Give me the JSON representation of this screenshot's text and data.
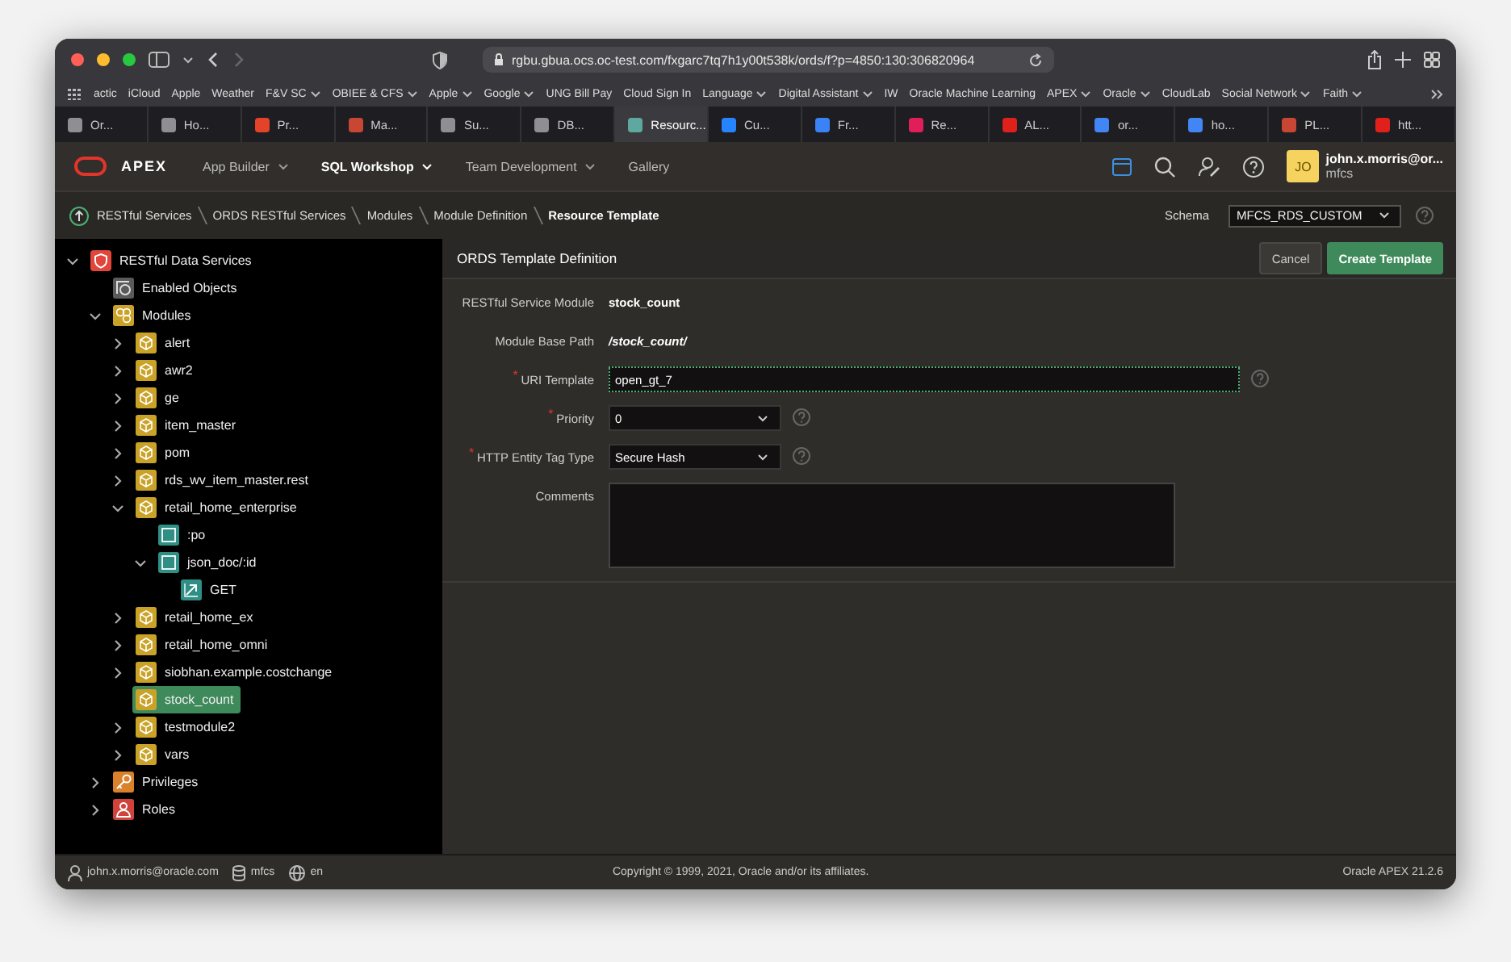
{
  "browser": {
    "url": "rgbu.gbua.ocs.oc-test.com/fxgarc7tq7h1y00t538k/ords/f?p=4850:130:306820964",
    "bookmarks": [
      {
        "label": "actic",
        "menu": false
      },
      {
        "label": "iCloud",
        "menu": false
      },
      {
        "label": "Apple",
        "menu": false
      },
      {
        "label": "Weather",
        "menu": false
      },
      {
        "label": "F&V SC",
        "menu": true
      },
      {
        "label": "OBIEE & CFS",
        "menu": true
      },
      {
        "label": "Apple",
        "menu": true
      },
      {
        "label": "Google",
        "menu": true
      },
      {
        "label": "UNG Bill Pay",
        "menu": false
      },
      {
        "label": "Cloud Sign In",
        "menu": false
      },
      {
        "label": "Language",
        "menu": true
      },
      {
        "label": "Digital Assistant",
        "menu": true
      },
      {
        "label": "IW",
        "menu": false
      },
      {
        "label": "Oracle Machine Learning",
        "menu": false
      },
      {
        "label": "APEX",
        "menu": true
      },
      {
        "label": "Oracle",
        "menu": true
      },
      {
        "label": "CloudLab",
        "menu": false
      },
      {
        "label": "Social Network",
        "menu": true
      },
      {
        "label": "Faith",
        "menu": true
      }
    ],
    "tabs": [
      {
        "label": "Or...",
        "selected": false,
        "color": "#8e8e93"
      },
      {
        "label": "Ho...",
        "selected": false,
        "color": "#8e8e93"
      },
      {
        "label": "Pr...",
        "selected": false,
        "color": "#e24329"
      },
      {
        "label": "Ma...",
        "selected": false,
        "color": "#c74634"
      },
      {
        "label": "Su...",
        "selected": false,
        "color": "#8e8e93"
      },
      {
        "label": "DB...",
        "selected": false,
        "color": "#8e8e93"
      },
      {
        "label": "Resourc...",
        "selected": true,
        "color": "#5fa8a0"
      },
      {
        "label": "Cu...",
        "selected": false,
        "color": "#2684ff"
      },
      {
        "label": "Fr...",
        "selected": false,
        "color": "#3b82f6"
      },
      {
        "label": "Re...",
        "selected": false,
        "color": "#e01e5a"
      },
      {
        "label": "AL...",
        "selected": false,
        "color": "#e0201b"
      },
      {
        "label": "or...",
        "selected": false,
        "color": "#4285f4"
      },
      {
        "label": "ho...",
        "selected": false,
        "color": "#4285f4"
      },
      {
        "label": "PL...",
        "selected": false,
        "color": "#c74634"
      },
      {
        "label": "htt...",
        "selected": false,
        "color": "#e0201b"
      }
    ]
  },
  "apex": {
    "logo": "APEX",
    "nav": [
      {
        "label": "App Builder",
        "selected": false
      },
      {
        "label": "SQL Workshop",
        "selected": true
      },
      {
        "label": "Team Development",
        "selected": false
      },
      {
        "label": "Gallery",
        "selected": false
      }
    ],
    "user": {
      "initials": "JO",
      "name": "john.x.morris@or...",
      "workspace": "mfcs"
    }
  },
  "breadcrumb": [
    {
      "label": "RESTful Services",
      "current": false
    },
    {
      "label": "ORDS RESTful Services",
      "current": false
    },
    {
      "label": "Modules",
      "current": false
    },
    {
      "label": "Module Definition",
      "current": false
    },
    {
      "label": "Resource Template",
      "current": true
    }
  ],
  "schema": {
    "label": "Schema",
    "value": "MFCS_RDS_CUSTOM"
  },
  "tree": [
    {
      "label": "RESTful Data Services",
      "kind": "service",
      "expanded": true,
      "selected": false,
      "children": [
        {
          "label": "Enabled Objects",
          "kind": "objects",
          "selected": false
        },
        {
          "label": "Modules",
          "kind": "modules",
          "expanded": true,
          "selected": false,
          "children": [
            {
              "label": "alert",
              "kind": "module",
              "expanded": false,
              "selected": false
            },
            {
              "label": "awr2",
              "kind": "module",
              "expanded": false,
              "selected": false
            },
            {
              "label": "ge",
              "kind": "module",
              "expanded": false,
              "selected": false
            },
            {
              "label": "item_master",
              "kind": "module",
              "expanded": false,
              "selected": false
            },
            {
              "label": "pom",
              "kind": "module",
              "expanded": false,
              "selected": false
            },
            {
              "label": "rds_wv_item_master.rest",
              "kind": "module",
              "expanded": false,
              "selected": false
            },
            {
              "label": "retail_home_enterprise",
              "kind": "module",
              "expanded": true,
              "selected": false,
              "children": [
                {
                  "label": ":po",
                  "kind": "template",
                  "selected": false
                },
                {
                  "label": "json_doc/:id",
                  "kind": "template",
                  "expanded": true,
                  "selected": false,
                  "children": [
                    {
                      "label": "GET",
                      "kind": "handler",
                      "selected": false
                    }
                  ]
                }
              ]
            },
            {
              "label": "retail_home_ex",
              "kind": "module",
              "expanded": false,
              "selected": false
            },
            {
              "label": "retail_home_omni",
              "kind": "module",
              "expanded": false,
              "selected": false
            },
            {
              "label": "siobhan.example.costchange",
              "kind": "module",
              "expanded": false,
              "selected": false
            },
            {
              "label": "stock_count",
              "kind": "module",
              "selected": true
            },
            {
              "label": "testmodule2",
              "kind": "module",
              "expanded": false,
              "selected": false
            },
            {
              "label": "vars",
              "kind": "module",
              "expanded": false,
              "selected": false
            }
          ]
        },
        {
          "label": "Privileges",
          "kind": "privileges",
          "expanded": false,
          "selected": false
        },
        {
          "label": "Roles",
          "kind": "roles",
          "expanded": false,
          "selected": false
        }
      ]
    }
  ],
  "form": {
    "title": "ORDS Template Definition",
    "buttons": [
      {
        "label": "Cancel",
        "kind": "secondary"
      },
      {
        "label": "Create Template",
        "kind": "primary"
      }
    ],
    "fields": [
      {
        "label": "RESTful Service Module",
        "kind": "display",
        "value": "stock_count",
        "help": false
      },
      {
        "label": "Module Base Path",
        "kind": "path",
        "value": "/stock_count/",
        "help": false
      },
      {
        "label": "URI Template",
        "kind": "text",
        "value": "open_gt_7",
        "required_mark": "*",
        "help": true,
        "focused": true
      },
      {
        "label": "Priority",
        "kind": "select",
        "value": "0",
        "required_mark": "*",
        "help": true
      },
      {
        "label": "HTTP Entity Tag Type",
        "kind": "select",
        "value": "Secure Hash",
        "required_mark": "*",
        "help": true
      },
      {
        "label": "Comments",
        "kind": "textarea",
        "help": false
      }
    ]
  },
  "footer": {
    "user": "john.x.morris@oracle.com",
    "workspace": "mfcs",
    "language": "en",
    "copyright": "Copyright © 1999, 2021, Oracle and/or its affiliates.",
    "version": "Oracle APEX 21.2.6"
  }
}
